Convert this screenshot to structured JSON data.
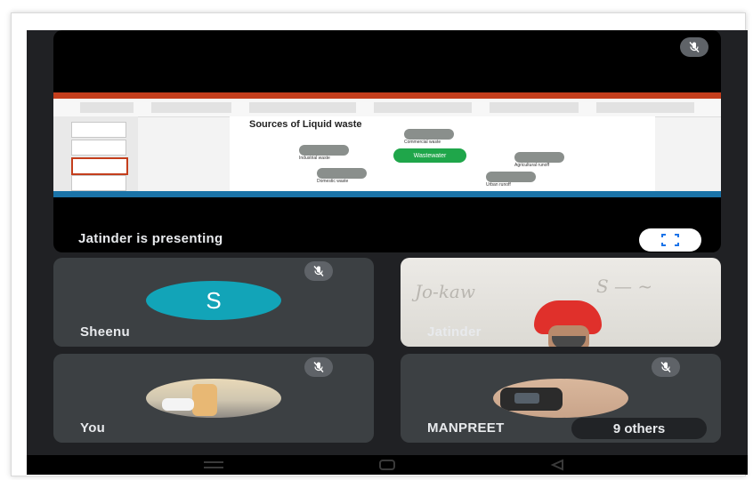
{
  "presentation": {
    "presenting_label": "Jatinder is presenting",
    "slide": {
      "title": "Sources of Liquid waste",
      "center_node": "Wastewater",
      "nodes": [
        {
          "label": "Commercial waste"
        },
        {
          "label": "Industrial waste"
        },
        {
          "label": "Domestic waste"
        },
        {
          "label": "Agricultural runoff"
        },
        {
          "label": "Urban runoff"
        }
      ]
    }
  },
  "participants": [
    {
      "name": "Sheenu",
      "avatar_letter": "S",
      "muted": true
    },
    {
      "name": "Jatinder",
      "muted": false
    },
    {
      "name": "You",
      "muted": true
    },
    {
      "name": "MANPREET",
      "muted": true
    }
  ],
  "others_label": "9 others",
  "colors": {
    "background": "#202124",
    "tile": "#3c4043",
    "avatar": "#12a4b8",
    "mic_badge": "#5f6368"
  },
  "icons": {
    "muted": "mic-off-icon",
    "fullscreen": "fullscreen-icon",
    "nav_recent": "recent-apps-icon",
    "nav_home": "home-icon",
    "nav_back": "back-icon"
  }
}
